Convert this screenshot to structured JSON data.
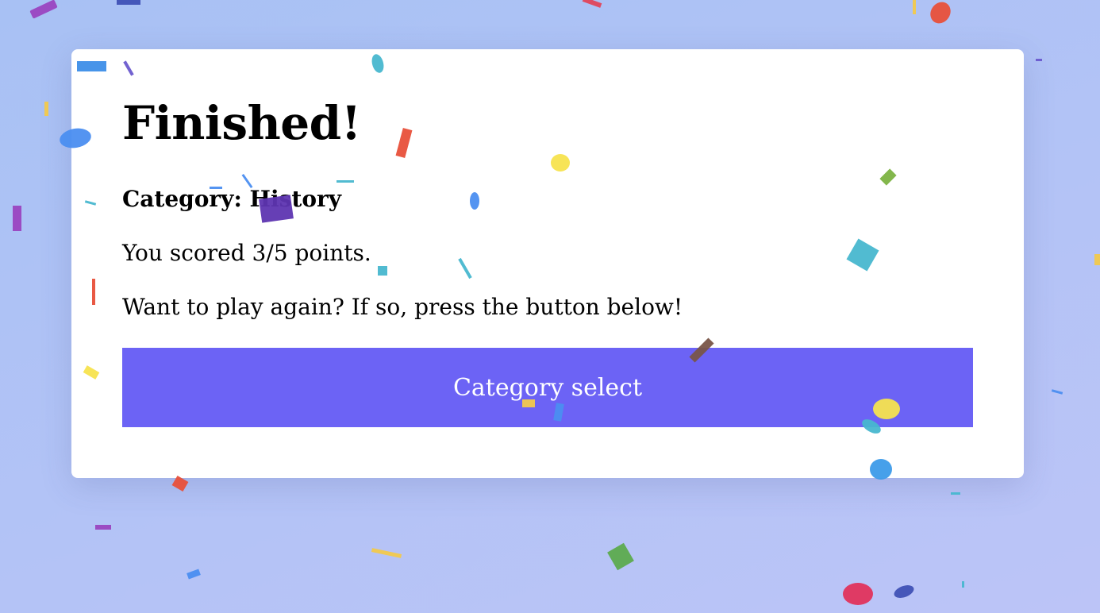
{
  "result": {
    "title": "Finished!",
    "category_line": "Category: History",
    "score_line": "You scored 3/5 points.",
    "prompt_line": "Want to play again? If so, press the button below!"
  },
  "actions": {
    "category_select_label": "Category select"
  },
  "colors": {
    "background": "#a8c1f4",
    "card": "#ffffff",
    "button": "#6c63f5",
    "button_text": "#ffffff"
  }
}
